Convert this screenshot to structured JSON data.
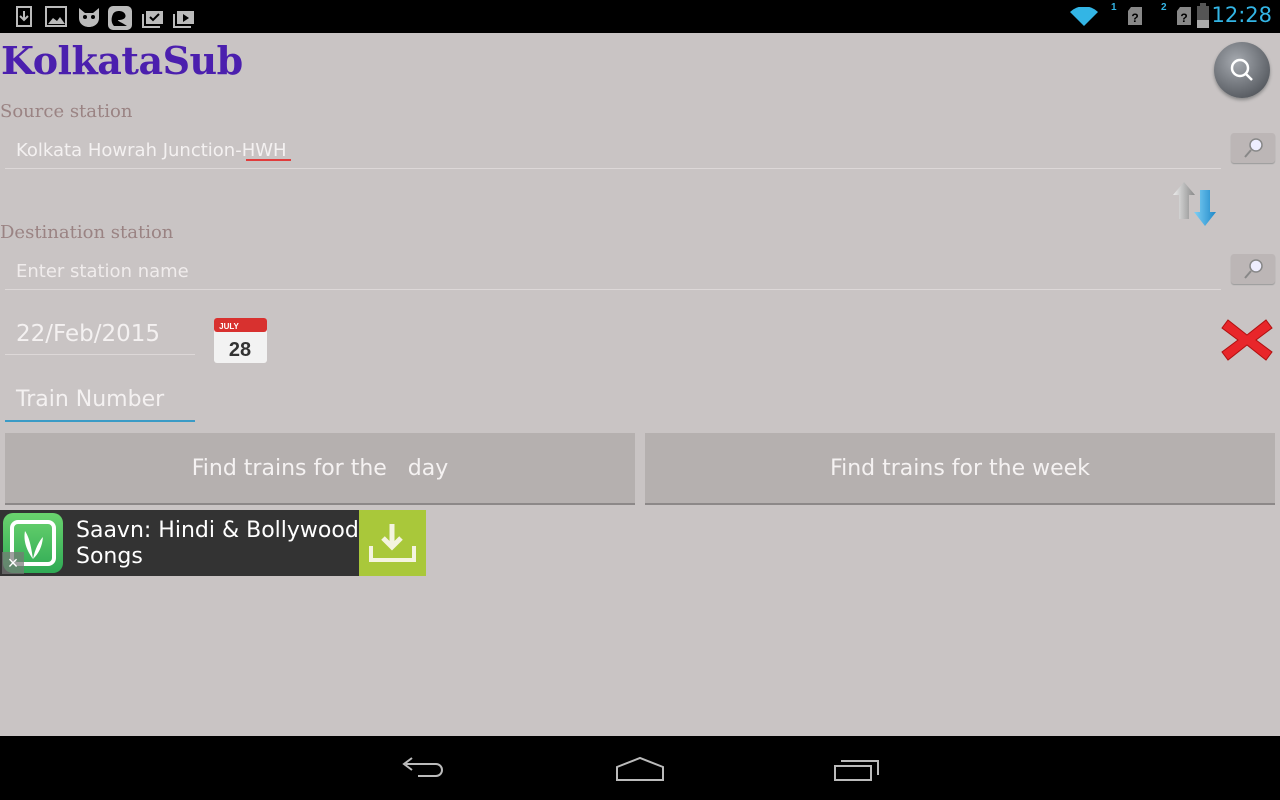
{
  "status_bar": {
    "notification_icons": [
      "download-icon",
      "image-icon",
      "cat-app-icon",
      "app-icon",
      "briefcase-check-icon",
      "briefcase-play-icon"
    ],
    "sim1_label": "1",
    "sim2_label": "2",
    "time": "12:28"
  },
  "app": {
    "title": "KolkataSub",
    "source_label": "Source station",
    "source_value": "Kolkata Howrah Junction-HWH",
    "destination_label": "Destination station",
    "destination_placeholder": "Enter station name",
    "date_value": "22/Feb/2015",
    "calendar_month": "JULY",
    "calendar_day": "28",
    "train_number_placeholder": "Train Number",
    "find_day_label": "Find trains for the   day",
    "find_week_label": "Find trains for the week"
  },
  "ad": {
    "text_line1": "Saavn: Hindi & Bollywood",
    "text_line2": "Songs",
    "close_glyph": "×"
  },
  "colors": {
    "title": "#4b1fae",
    "accent": "#33b5e5",
    "background": "#c9c4c4",
    "ad_button": "#a9c83a"
  }
}
